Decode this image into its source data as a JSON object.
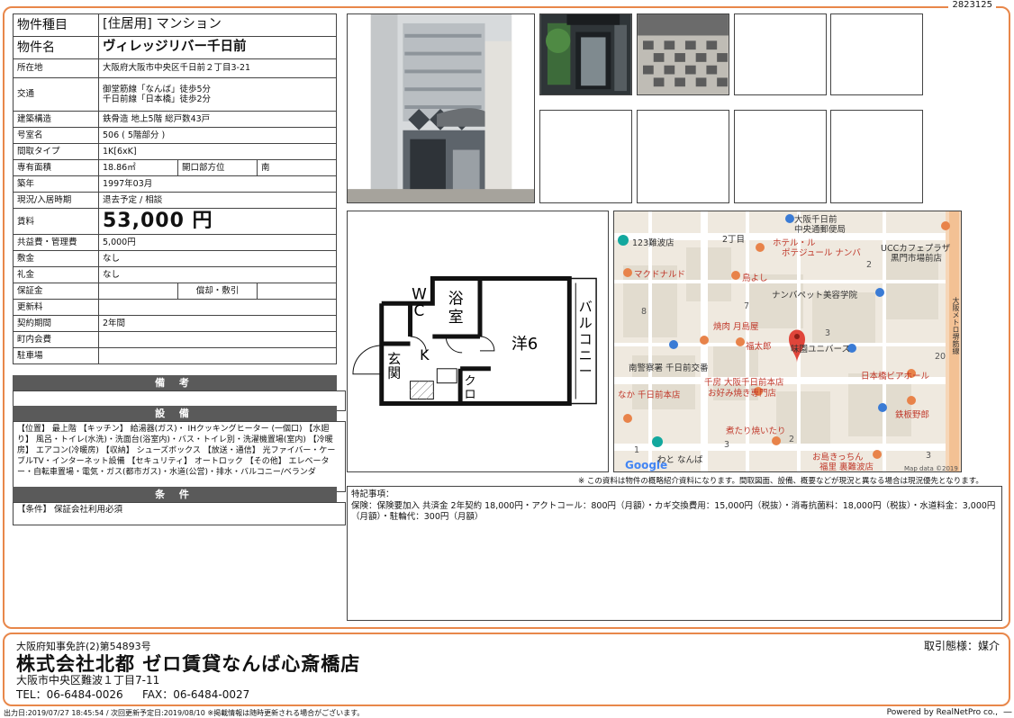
{
  "ref_no": "2823125",
  "rows": {
    "type": {
      "label": "物件種目",
      "value": "[住居用] マンション"
    },
    "name": {
      "label": "物件名",
      "value": "ヴィレッジリバー千日前"
    },
    "address": {
      "label": "所在地",
      "value": "大阪府大阪市中央区千日前２丁目3-21"
    },
    "transit": {
      "label": "交通",
      "line1": "御堂筋線「なんば」徒歩5分",
      "line2": "千日前線「日本橋」徒歩2分"
    },
    "structure": {
      "label": "建築構造",
      "value": "鉄骨造 地上5階 総戸数43戸"
    },
    "room_no": {
      "label": "号室名",
      "value": "506 ( 5階部分 )"
    },
    "layout": {
      "label": "間取タイプ",
      "value": "1K[6xK]"
    },
    "area": {
      "label": "専有面積",
      "value": "18.86㎡",
      "dir_label": "開口部方位",
      "dir_value": "南"
    },
    "built": {
      "label": "築年",
      "value": "1997年03月"
    },
    "status": {
      "label": "現況/入居時期",
      "value": "退去予定 / 相談"
    },
    "rent": {
      "label": "賃料",
      "value": "53,000 円"
    },
    "common_fee": {
      "label": "共益費・管理費",
      "value": "5,000円"
    },
    "deposit": {
      "label": "敷金",
      "value": "なし"
    },
    "key_money": {
      "label": "礼金",
      "value": "なし"
    },
    "guarantee": {
      "label": "保証金",
      "value": "",
      "sub_label": "償却・敷引",
      "sub_value": ""
    },
    "renewal": {
      "label": "更新料",
      "value": ""
    },
    "contract": {
      "label": "契約期間",
      "value": "2年間"
    },
    "community": {
      "label": "町内会費",
      "value": ""
    },
    "parking": {
      "label": "駐車場",
      "value": ""
    }
  },
  "sections": {
    "remarks_title": "備 考",
    "remarks_text": "",
    "facilities_title": "設 備",
    "facilities_text": "【位置】 最上階 【キッチン】 給湯器(ガス)・ IHクッキングヒーター (一個口) 【水廻り】 風呂・トイレ(水洗)・洗面台(浴室内)・バス・トイレ別・洗濯機置場(室内) 【冷暖房】 エアコン(冷暖房) 【収納】 シューズボックス 【放送・通信】 光ファイバー・ケーブルTV・インターネット設備 【セキュリティ】 オートロック 【その他】 エレベーター・自転車置場・電気・ガス(都市ガス)・水道(公営)・排水・バルコニー/ベランダ",
    "conditions_title": "条 件",
    "conditions_text": "【条件】 保証会社利用必須"
  },
  "floor_plan": {
    "wc": [
      "W",
      "C"
    ],
    "bath": [
      "浴",
      "室"
    ],
    "entrance": [
      "玄",
      "関"
    ],
    "kitchen": "K",
    "closet": [
      "ク",
      "ロ"
    ],
    "room": "洋6",
    "balcony": [
      "バ",
      "ル",
      "コ",
      "ニ",
      "ー"
    ]
  },
  "map": {
    "labels": [
      "大阪千日前",
      "中央通郵便局",
      "123難波店",
      "2丁目",
      "ホテル・ル",
      "ポテジュール ナンバ",
      "UCCカフェプラザ",
      "黒門市場前店",
      "マクドナルド",
      "鳥よし",
      "ナンバペット美容学院",
      "焼肉 月島屋",
      "福太郎",
      "味園ユニバース",
      "日本橋ビアホール",
      "南警察署 千日前交番",
      "千房 大阪千日前本店",
      "お好み焼き専門店",
      "なか 千日前本店",
      "鉄板野郎",
      "煮たり焼いたり",
      "お島きっちん",
      "福里 裏難波店",
      "わと なんば",
      "大阪メトロ堺筋線",
      "Map data ©2019"
    ],
    "numbers": [
      "2",
      "7",
      "8",
      "3",
      "20",
      "2",
      "3",
      "3",
      "1"
    ],
    "google": "Google"
  },
  "note": "※ この資料は物件の概略紹介資料になります。間取図面、設備、概要などが現況と異なる場合は現況優先となります。",
  "special": {
    "title": "特記事項：",
    "text": "保険：保険要加入 共済金 2年契約 18,000円・アクトコール：800円（月額）・カギ交換費用：15,000円（税抜）・消毒抗菌料：18,000円（税抜）・水道料金：3,000円（月額）・駐輪代：300円（月額）"
  },
  "agent": {
    "license": "大阪府知事免許(2)第54893号",
    "company": "株式会社北都 ゼロ賃貸なんば心斎橋店",
    "address": "大阪市中央区難波１丁目7-11",
    "tel": "TEL：06-6484-0026",
    "fax": "FAX：06-6484-0027",
    "transaction": "取引態様：媒介"
  },
  "footer": {
    "left": "出力日:2019/07/27 18:45:54 / 次回更新予定日:2019/08/10 ※掲載情報は随時更新される場合がございます。",
    "right": "Powered by RealNetPro co.,",
    "dots": "—"
  },
  "colors": {
    "frame": "#e8874a",
    "header_bg": "#5a5a5a",
    "pin": "#e0453a"
  }
}
